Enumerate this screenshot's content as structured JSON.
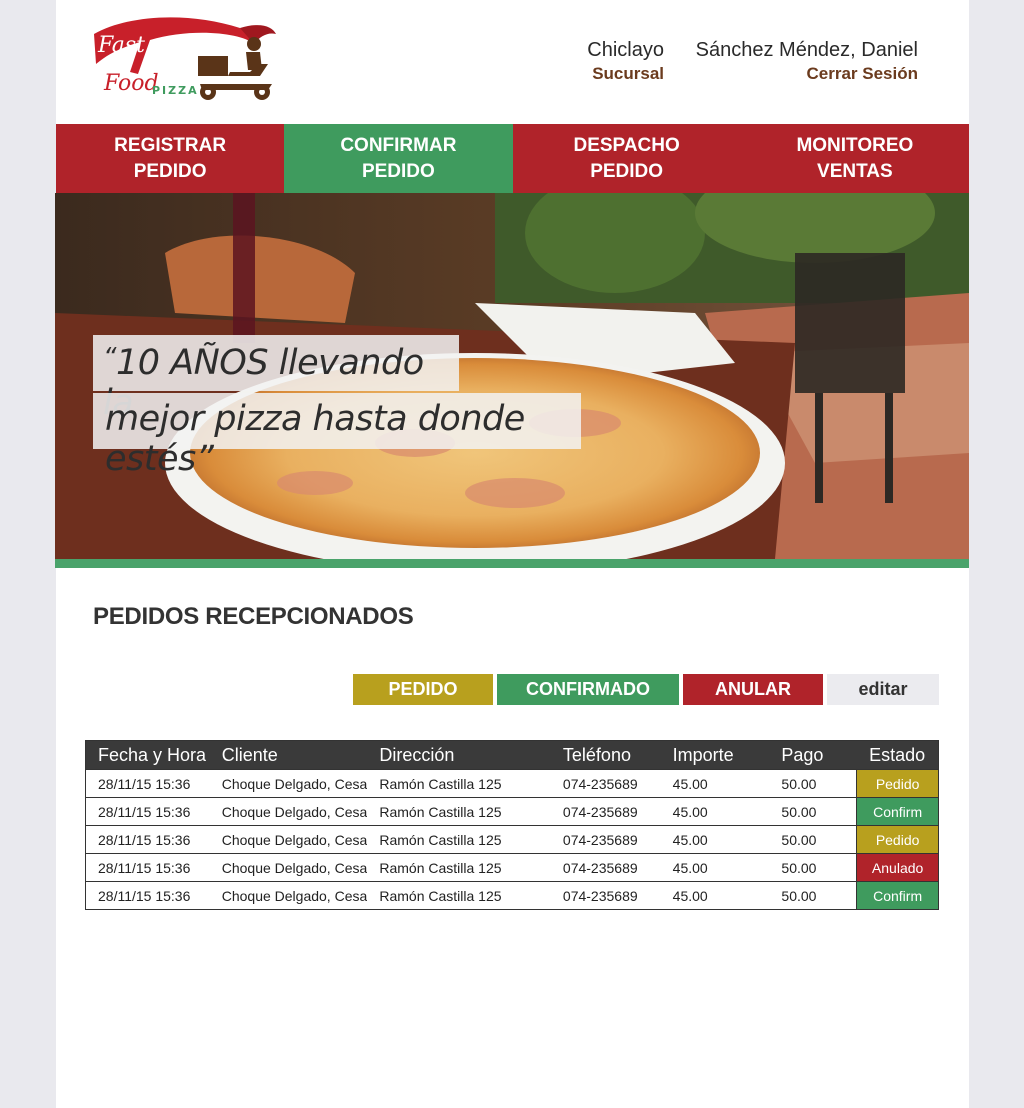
{
  "header": {
    "city": "Chiclayo",
    "city_sub": "Sucursal",
    "user": "Sánchez Méndez, Daniel",
    "logout": "Cerrar Sesión",
    "logo_text": {
      "fast": "Fast",
      "food": "Food",
      "pizza": "PIZZA"
    }
  },
  "nav": {
    "items": [
      {
        "line1": "REGISTRAR",
        "line2": "PEDIDO"
      },
      {
        "line1": "CONFIRMAR",
        "line2": "PEDIDO"
      },
      {
        "line1": "DESPACHO",
        "line2": "PEDIDO"
      },
      {
        "line1": "MONITOREO",
        "line2": "VENTAS"
      }
    ],
    "active_index": 1
  },
  "hero": {
    "quote_line1": "10 AÑOS llevando  la",
    "quote_line2": "mejor pizza hasta donde estés",
    "open_quote": "“",
    "close_quote": "”"
  },
  "section": {
    "title": "PEDIDOS RECEPCIONADOS"
  },
  "legend": {
    "pedido": "PEDIDO",
    "confirmado": "CONFIRMADO",
    "anular": "ANULAR",
    "editar": "editar"
  },
  "table": {
    "headers": [
      "Fecha y Hora",
      "Cliente",
      "Dirección",
      "Teléfono",
      "Importe",
      "Pago",
      "Estado"
    ],
    "rows": [
      {
        "fecha": "28/11/15  15:36",
        "cliente": "Choque Delgado, Cesa",
        "direccion": "Ramón Castilla 125",
        "telefono": "074-235689",
        "importe": "45.00",
        "pago": "50.00",
        "estado": "Pedido"
      },
      {
        "fecha": "28/11/15  15:36",
        "cliente": "Choque Delgado, Cesa",
        "direccion": "Ramón Castilla 125",
        "telefono": "074-235689",
        "importe": "45.00",
        "pago": "50.00",
        "estado": "Confirm"
      },
      {
        "fecha": "28/11/15  15:36",
        "cliente": "Choque Delgado, Cesa",
        "direccion": "Ramón Castilla 125",
        "telefono": "074-235689",
        "importe": "45.00",
        "pago": "50.00",
        "estado": "Pedido"
      },
      {
        "fecha": "28/11/15  15:36",
        "cliente": "Choque Delgado, Cesa",
        "direccion": "Ramón Castilla 125",
        "telefono": "074-235689",
        "importe": "45.00",
        "pago": "50.00",
        "estado": "Anulado"
      },
      {
        "fecha": "28/11/15  15:36",
        "cliente": "Choque Delgado, Cesa",
        "direccion": "Ramón Castilla 125",
        "telefono": "074-235689",
        "importe": "45.00",
        "pago": "50.00",
        "estado": "Confirm"
      }
    ]
  },
  "colors": {
    "brand_red": "#b0232a",
    "brand_green": "#3f9b5e",
    "pending_yellow": "#b8a01e",
    "accent_brown": "#6b3b1e"
  }
}
